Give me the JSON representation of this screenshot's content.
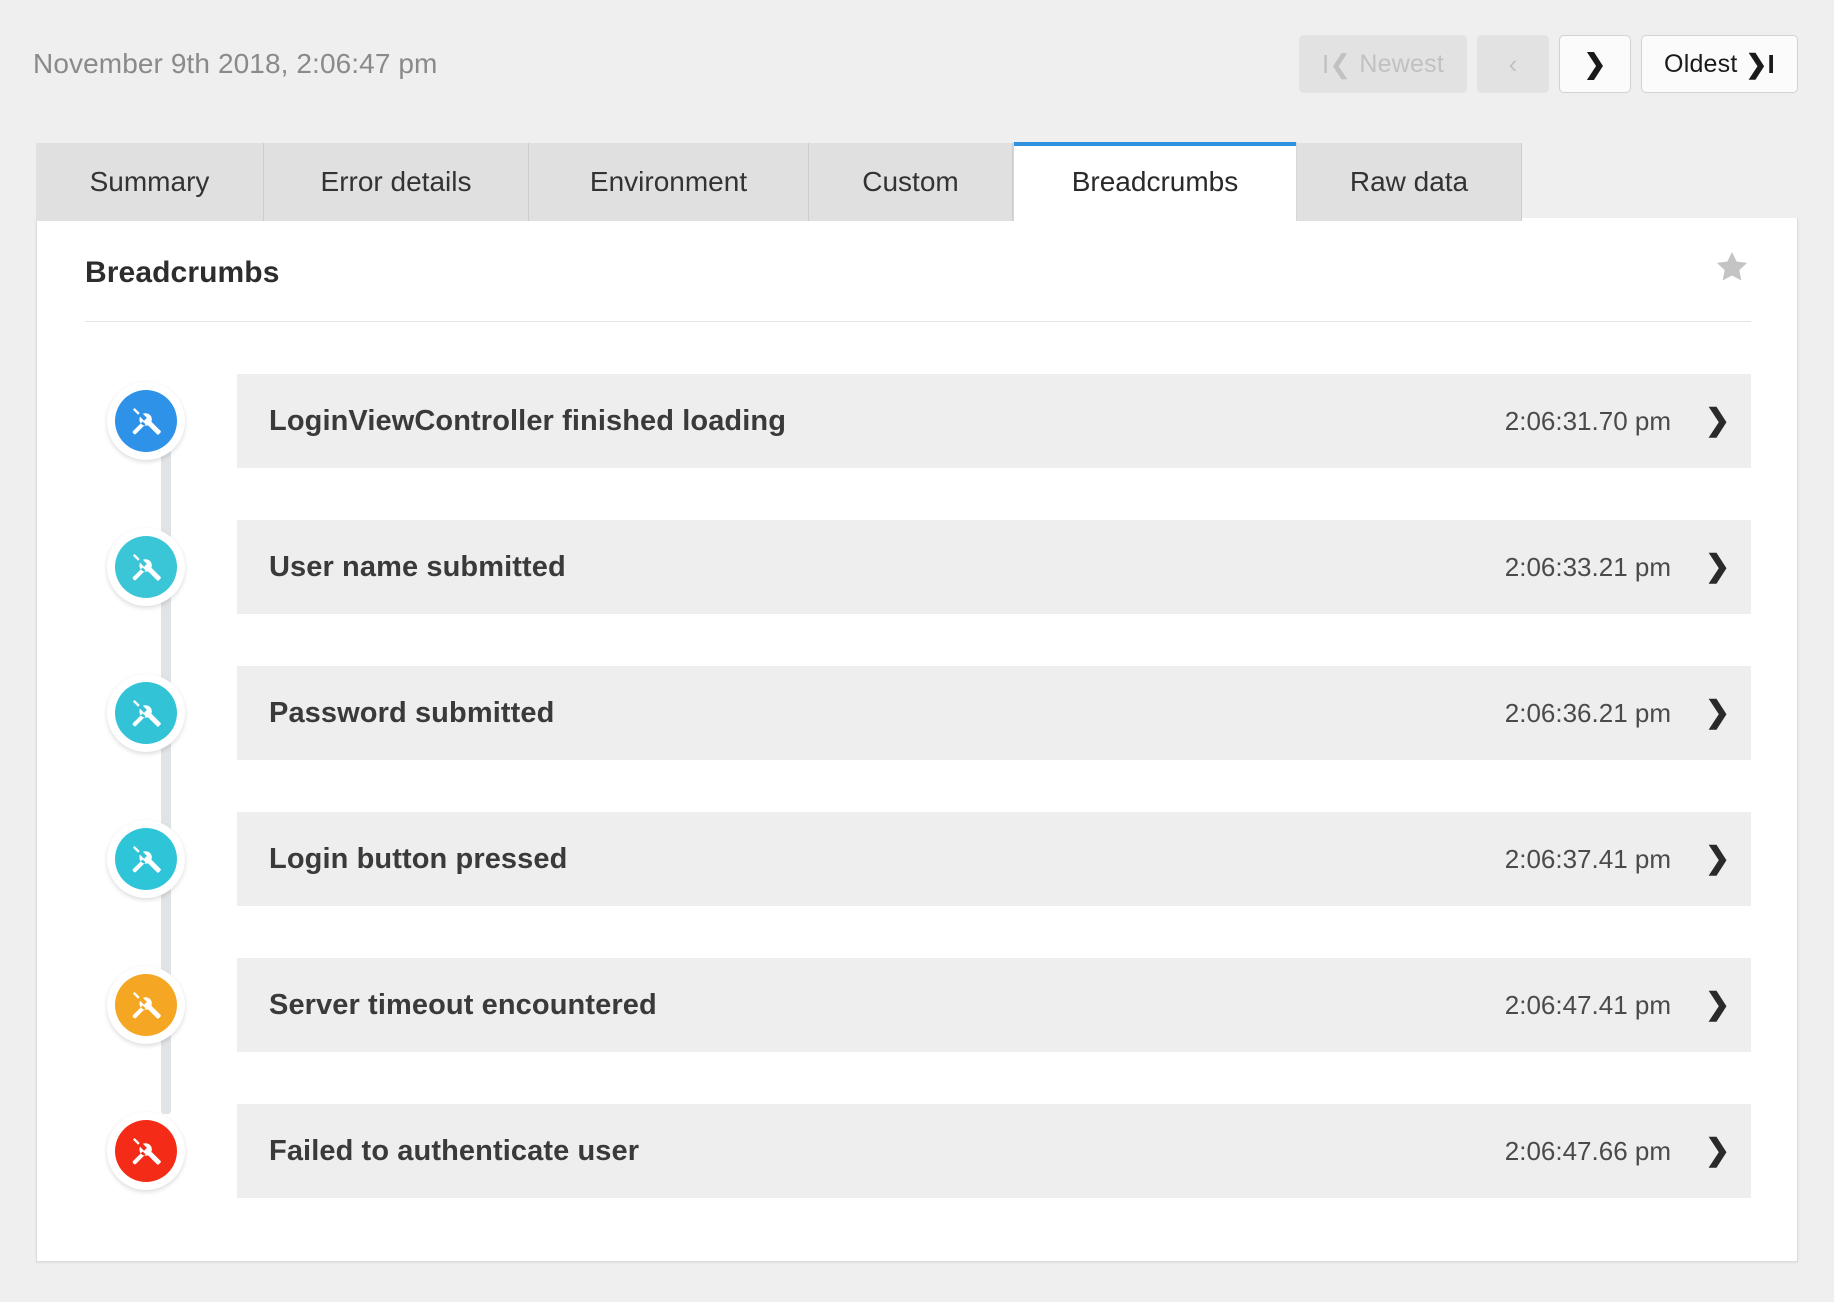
{
  "header": {
    "event_timestamp": "November 9th 2018, 2:06:47 pm",
    "nav": {
      "newest_label": "Newest",
      "newest_icon": "first-page-icon",
      "newest_glyph": "I❮",
      "prev_label": "",
      "prev_icon": "chevron-left-icon",
      "prev_glyph": "‹",
      "next_label": "",
      "next_icon": "chevron-right-icon",
      "next_glyph": "❯",
      "oldest_label": "Oldest",
      "oldest_icon": "last-page-icon",
      "oldest_glyph": "❯I"
    }
  },
  "tabs": [
    {
      "label": "Summary",
      "active": false
    },
    {
      "label": "Error details",
      "active": false
    },
    {
      "label": "Environment",
      "active": false
    },
    {
      "label": "Custom",
      "active": false
    },
    {
      "label": "Breadcrumbs",
      "active": true
    },
    {
      "label": "Raw data",
      "active": false
    }
  ],
  "card": {
    "title": "Breadcrumbs",
    "favorite_icon": "star-icon",
    "accent_color": "#2e92e0"
  },
  "breadcrumbs": [
    {
      "label": "LoginViewController finished loading",
      "time": "2:06:31.70 pm",
      "icon": "tools-icon",
      "color": "#2e92e8",
      "chevron": "❯"
    },
    {
      "label": "User name submitted",
      "time": "2:06:33.21 pm",
      "icon": "tools-icon",
      "color": "#3bc6d8",
      "chevron": "❯"
    },
    {
      "label": "Password submitted",
      "time": "2:06:36.21 pm",
      "icon": "tools-icon",
      "color": "#33c3d6",
      "chevron": "❯"
    },
    {
      "label": "Login button pressed",
      "time": "2:06:37.41 pm",
      "icon": "tools-icon",
      "color": "#2ec5d9",
      "chevron": "❯"
    },
    {
      "label": "Server timeout encountered",
      "time": "2:06:47.41 pm",
      "icon": "tools-icon",
      "color": "#f5a623",
      "chevron": "❯"
    },
    {
      "label": "Failed to authenticate user",
      "time": "2:06:47.66 pm",
      "icon": "tools-icon",
      "color": "#f42b16",
      "chevron": "❯"
    }
  ]
}
